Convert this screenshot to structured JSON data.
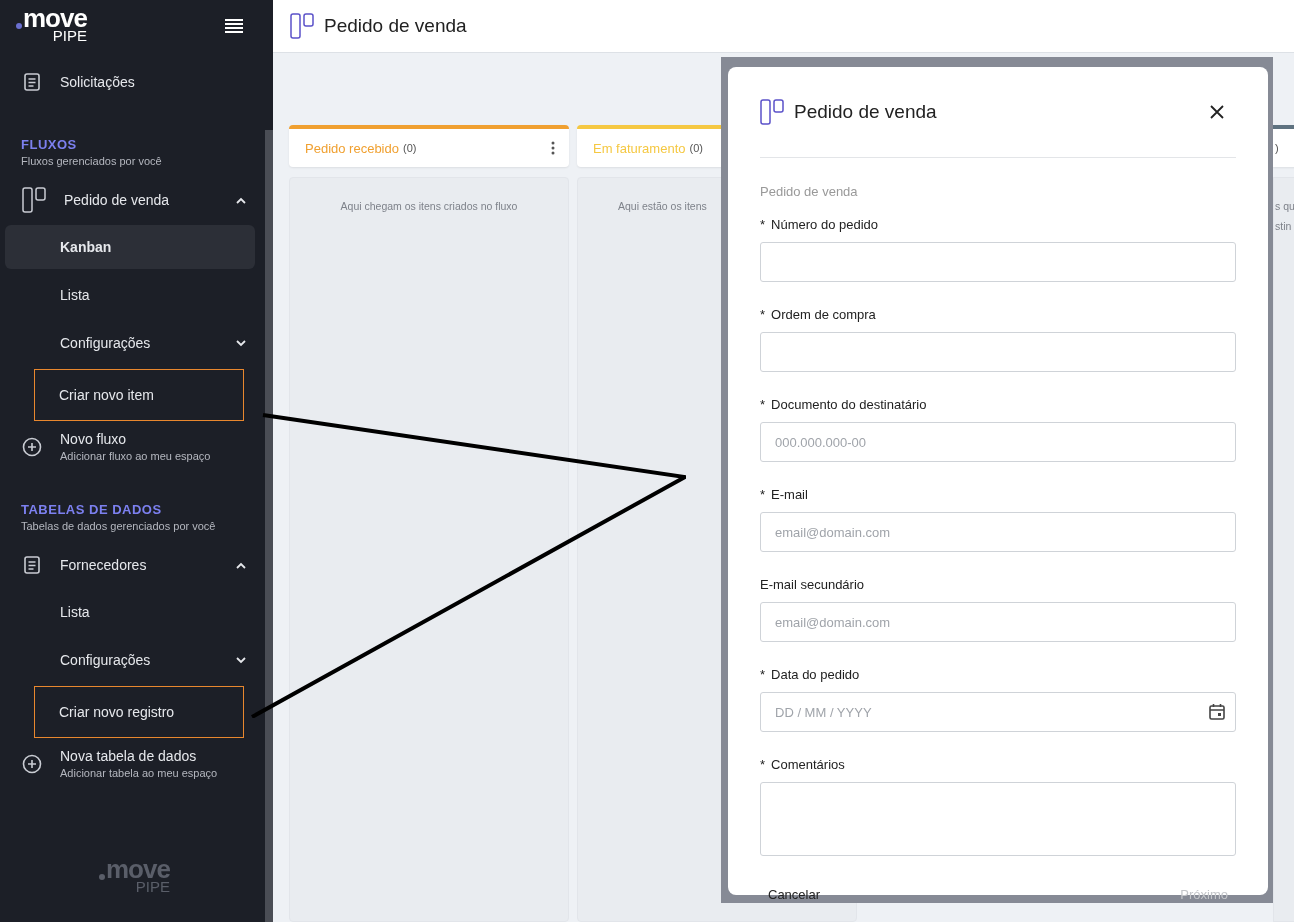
{
  "sidebar": {
    "logo": {
      "name": "move",
      "sub": "PIPE"
    },
    "top_items": [
      {
        "label": "Solicitações",
        "kind": "document"
      }
    ],
    "sections": [
      {
        "title": "FLUXOS",
        "subtitle": "Fluxos gerenciados por você",
        "group": {
          "label": "Pedido de venda",
          "kind": "kanban",
          "expanded": true,
          "children": [
            {
              "label": "Kanban",
              "selected": true,
              "highlighted": false,
              "expandable": false
            },
            {
              "label": "Lista",
              "selected": false,
              "highlighted": false,
              "expandable": false
            },
            {
              "label": "Configurações",
              "selected": false,
              "highlighted": false,
              "expandable": true
            },
            {
              "label": "Criar novo item",
              "selected": false,
              "highlighted": true,
              "expandable": false
            }
          ]
        },
        "add": {
          "label": "Novo fluxo",
          "subtitle": "Adicionar fluxo ao meu espaço"
        }
      },
      {
        "title": "TABELAS DE DADOS",
        "subtitle": "Tabelas de dados gerenciados por você",
        "group": {
          "label": "Fornecedores",
          "kind": "document",
          "expanded": true,
          "children": [
            {
              "label": "Lista",
              "selected": false,
              "highlighted": false,
              "expandable": false
            },
            {
              "label": "Configurações",
              "selected": false,
              "highlighted": false,
              "expandable": true
            },
            {
              "label": "Criar novo registro",
              "selected": false,
              "highlighted": true,
              "expandable": false
            }
          ]
        },
        "add": {
          "label": "Nova tabela de dados",
          "subtitle": "Adicionar tabela ao meu espaço"
        }
      }
    ],
    "footer_logo": {
      "name": "move",
      "sub": "PIPE"
    }
  },
  "header": {
    "title": "Pedido de venda"
  },
  "board": {
    "columns": [
      {
        "title": "Pedido recebido",
        "count": "(0)",
        "color": "#f0a030",
        "description": [
          "Aqui chegam os itens criados no fluxo"
        ]
      },
      {
        "title": "Em faturamento",
        "count": "(0)",
        "color": "#f5c842",
        "description": [
          "Aqui estão os itens"
        ]
      },
      {
        "count": ")",
        "color": "#5f7280",
        "description": [
          "s qu",
          "stin"
        ]
      }
    ]
  },
  "modal": {
    "title": "Pedido de venda",
    "section": "Pedido de venda",
    "fields": [
      {
        "label": "Número do pedido",
        "required_mark": "*",
        "kind": "text"
      },
      {
        "label": "Ordem de compra",
        "required_mark": "*",
        "kind": "text"
      },
      {
        "label": "Documento do destinatário",
        "required_mark": "*",
        "kind": "text",
        "placeholder": "000.000.000-00"
      },
      {
        "label": "E-mail",
        "required_mark": "*",
        "kind": "text",
        "placeholder": "email@domain.com"
      },
      {
        "label": "E-mail secundário",
        "kind": "text",
        "placeholder": "email@domain.com"
      },
      {
        "label": "Data do pedido",
        "required_mark": "*",
        "kind": "date",
        "placeholder": "DD / MM / YYYY"
      },
      {
        "label": "Comentários",
        "required_mark": "*",
        "kind": "textarea"
      }
    ],
    "cancel": "Cancelar",
    "next": {
      "label": "Próximo",
      "disabled": true
    }
  }
}
